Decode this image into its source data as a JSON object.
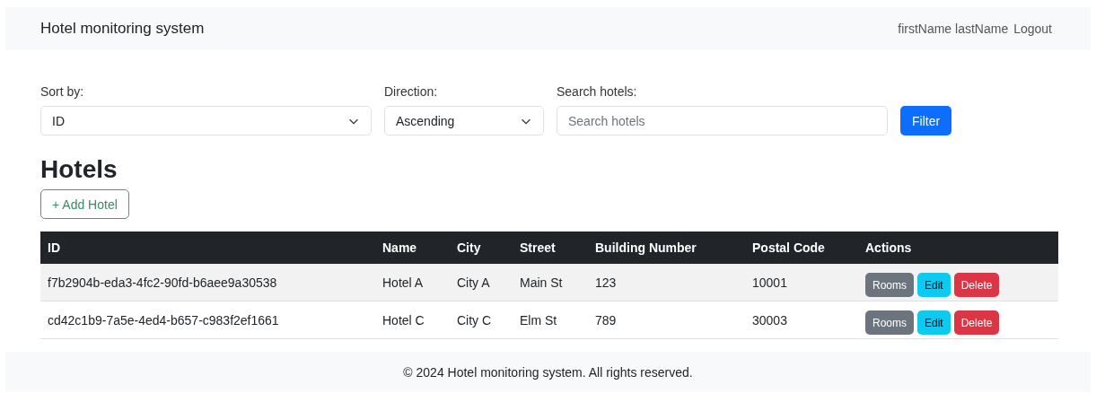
{
  "navbar": {
    "brand": "Hotel monitoring system",
    "user": "firstName lastName",
    "logout": "Logout"
  },
  "filters": {
    "sort": {
      "label": "Sort by:",
      "value": "ID"
    },
    "direction": {
      "label": "Direction:",
      "value": "Ascending"
    },
    "search": {
      "label": "Search hotels:",
      "placeholder": "Search hotels"
    },
    "filter_button": "Filter"
  },
  "heading": "Hotels",
  "add_button": "+ Add Hotel",
  "table": {
    "columns": [
      "ID",
      "Name",
      "City",
      "Street",
      "Building Number",
      "Postal Code",
      "Actions"
    ],
    "rows": [
      {
        "cells": [
          "f7b2904b-eda3-4fc2-90fd-b6aee9a30538",
          "Hotel A",
          "City A",
          "Main St",
          "123",
          "10001"
        ],
        "actions": [
          {
            "label": "Rooms",
            "kind": "secondary"
          },
          {
            "label": "Edit",
            "kind": "info"
          },
          {
            "label": "Delete",
            "kind": "danger"
          }
        ]
      },
      {
        "cells": [
          "cd42c1b9-7a5e-4ed4-b657-c983f2ef1661",
          "Hotel C",
          "City C",
          "Elm St",
          "789",
          "30003"
        ],
        "actions": [
          {
            "label": "Rooms",
            "kind": "secondary"
          },
          {
            "label": "Edit",
            "kind": "info"
          },
          {
            "label": "Delete",
            "kind": "danger"
          }
        ]
      }
    ]
  },
  "footer": "© 2024 Hotel monitoring system. All rights reserved."
}
